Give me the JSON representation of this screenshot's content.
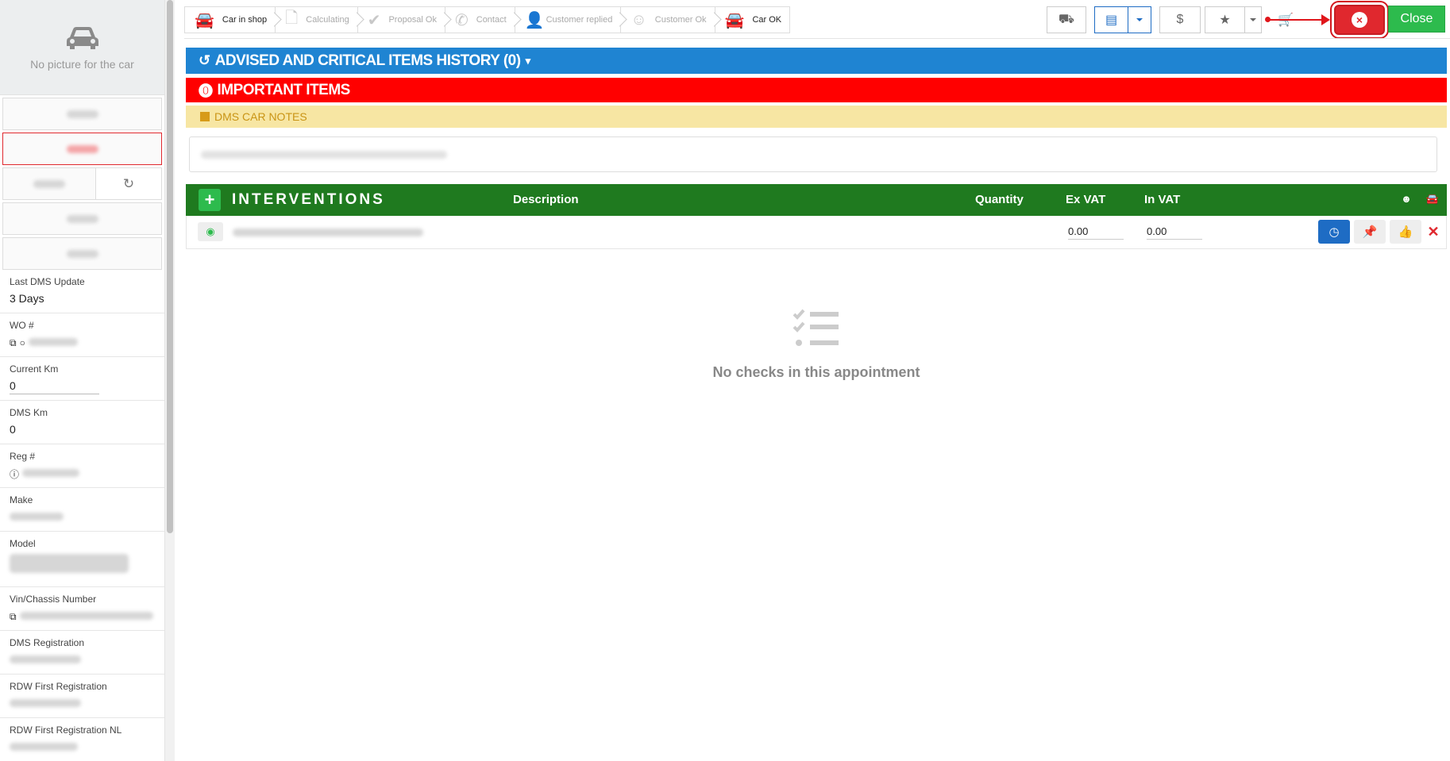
{
  "sidebar": {
    "no_picture": "No picture for the car",
    "fields": [
      {
        "label": "Last DMS Update",
        "value": "3 Days"
      },
      {
        "label": "WO #",
        "value": ""
      },
      {
        "label": "Current Km",
        "value": "0"
      },
      {
        "label": "DMS Km",
        "value": "0"
      },
      {
        "label": "Reg #",
        "value": ""
      },
      {
        "label": "Make",
        "value": ""
      },
      {
        "label": "Model",
        "value": ""
      },
      {
        "label": "Vin/Chassis Number",
        "value": ""
      },
      {
        "label": "DMS Registration",
        "value": ""
      },
      {
        "label": "RDW First Registration",
        "value": ""
      },
      {
        "label": "RDW First Registration NL",
        "value": ""
      }
    ],
    "refresh_icon": "↻"
  },
  "steps": [
    {
      "label": "Car in shop",
      "icon": "car-icon",
      "active": true
    },
    {
      "label": "Calculating",
      "icon": "file-icon",
      "active": false
    },
    {
      "label": "Proposal Ok",
      "icon": "check-icon",
      "active": false
    },
    {
      "label": "Contact",
      "icon": "phone-icon",
      "active": false
    },
    {
      "label": "Customer replied",
      "icon": "user-check-icon",
      "active": false
    },
    {
      "label": "Customer Ok",
      "icon": "smile-icon",
      "active": false
    },
    {
      "label": "Car OK",
      "icon": "car-icon",
      "active": true
    }
  ],
  "toolbar": {
    "dollar": "$",
    "close_label": "Close"
  },
  "sections": {
    "history": "ADVISED AND CRITICAL ITEMS HISTORY (0)",
    "important": "IMPORTANT ITEMS",
    "notes": "DMS CAR NOTES"
  },
  "interventions": {
    "title": "INTERVENTIONS",
    "columns": {
      "description": "Description",
      "quantity": "Quantity",
      "ex_vat": "Ex VAT",
      "in_vat": "In VAT"
    },
    "rows": [
      {
        "ex_vat": "0.00",
        "in_vat": "0.00"
      }
    ]
  },
  "empty_state": {
    "message": "No checks in this appointment"
  },
  "colors": {
    "blue": "#1f84d2",
    "red": "#ff0000",
    "green": "#1f7a1f",
    "accent_green": "#2dbb4d",
    "yellow": "#f7e6a3"
  }
}
